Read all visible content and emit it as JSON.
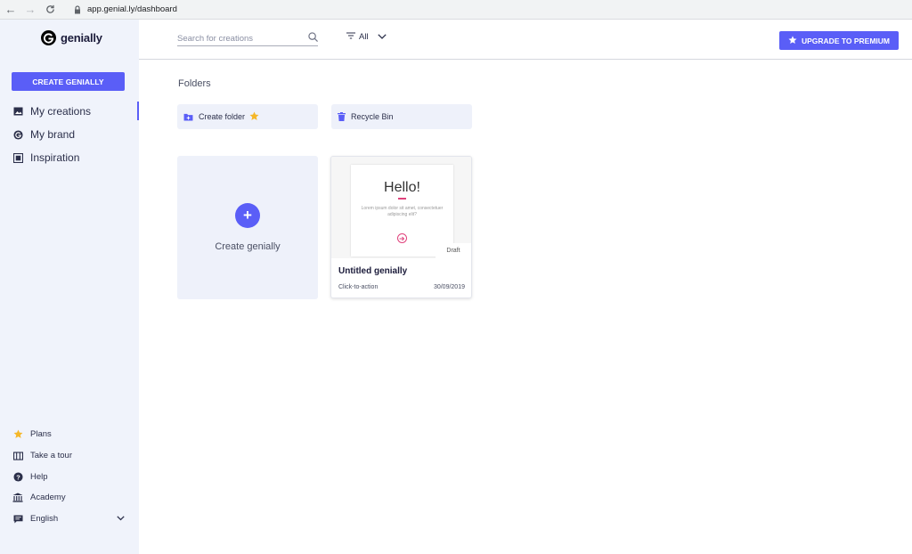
{
  "browser": {
    "url": "app.genial.ly/dashboard"
  },
  "brand": {
    "name": "genially",
    "accent": "#5a5ef7"
  },
  "sidebar": {
    "create_label": "CREATE GENIALLY",
    "items": [
      {
        "label": "My creations",
        "icon": "image-icon",
        "active": true
      },
      {
        "label": "My brand",
        "icon": "brand-icon",
        "active": false
      },
      {
        "label": "Inspiration",
        "icon": "inspiration-icon",
        "active": false
      }
    ],
    "footer": [
      {
        "label": "Plans",
        "icon": "star-icon"
      },
      {
        "label": "Take a tour",
        "icon": "tour-icon"
      },
      {
        "label": "Help",
        "icon": "help-icon"
      },
      {
        "label": "Academy",
        "icon": "academy-icon"
      },
      {
        "label": "English",
        "icon": "language-icon"
      }
    ]
  },
  "header": {
    "search_placeholder": "Search for creations",
    "filter_label": "All",
    "upgrade_label": "UPGRADE TO PREMIUM"
  },
  "main": {
    "folders_title": "Folders",
    "create_folder_label": "Create folder",
    "recycle_label": "Recycle Bin",
    "create_card_label": "Create genially",
    "creations": [
      {
        "title": "Untitled genially",
        "type": "Click-to-action",
        "date": "30/09/2019",
        "status": "Draft",
        "thumb_title": "Hello!",
        "thumb_text": "Lorem ipsum dolor sit amet, consectetuer adipiscing elit?"
      }
    ]
  }
}
